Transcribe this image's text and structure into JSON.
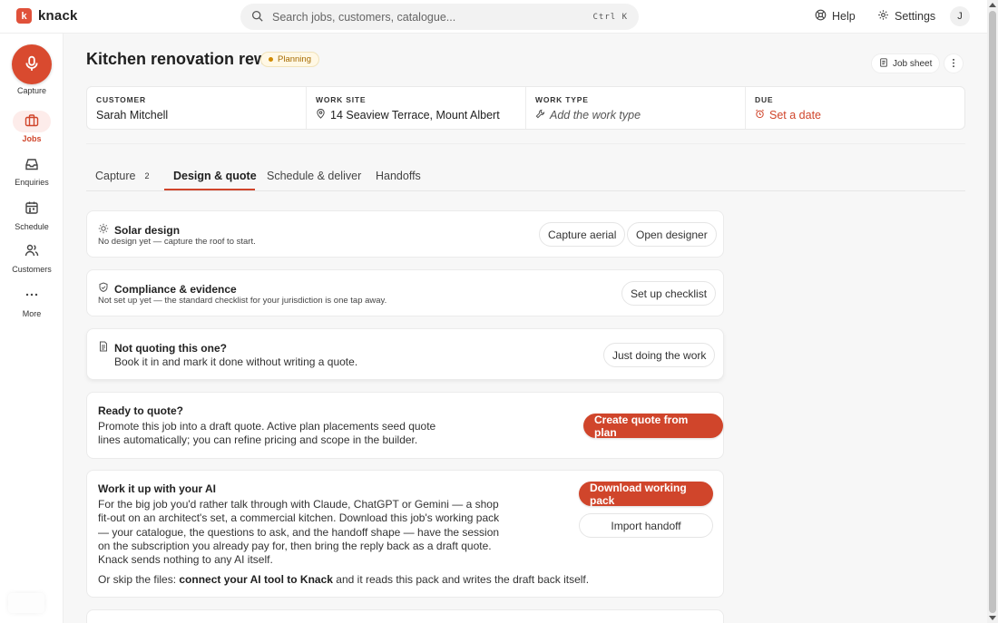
{
  "app": {
    "logo_letter": "k",
    "name": "knack"
  },
  "search": {
    "placeholder": "Search jobs, customers, catalogue...",
    "shortcut": "Ctrl K"
  },
  "topnav": {
    "help": "Help",
    "settings": "Settings",
    "avatar_initial": "J"
  },
  "sidebar": {
    "capture": "Capture",
    "items": [
      {
        "label": "Jobs",
        "icon": "briefcase-icon",
        "active": true
      },
      {
        "label": "Enquiries",
        "icon": "inbox-icon"
      },
      {
        "label": "Schedule",
        "icon": "calendar-icon"
      },
      {
        "label": "Customers",
        "icon": "users-icon"
      },
      {
        "label": "More",
        "icon": "dots-icon"
      }
    ]
  },
  "job": {
    "title": "Kitchen renovation rewire",
    "status": "Planning",
    "job_sheet": "Job sheet",
    "fields": {
      "customer_label": "CUSTOMER",
      "customer_value": "Sarah Mitchell",
      "site_label": "WORK SITE",
      "site_value": "14 Seaview Terrace, Mount Albert",
      "type_label": "WORK TYPE",
      "type_value": "Add the work type",
      "due_label": "DUE",
      "due_value": "Set a date"
    }
  },
  "tabs": {
    "capture": "Capture",
    "capture_count": "2",
    "design": "Design & quote",
    "schedule": "Schedule & deliver",
    "handoffs": "Handoffs"
  },
  "cards": {
    "solar": {
      "title": "Solar design",
      "sub": "No design yet — capture the roof to start.",
      "btn_aerial": "Capture aerial",
      "btn_designer": "Open designer"
    },
    "compliance": {
      "title": "Compliance & evidence",
      "sub": "Not set up yet — the standard checklist for your jurisdiction is one tap away.",
      "btn": "Set up checklist"
    },
    "noquote": {
      "title": "Not quoting this one?",
      "body": "Book it in and mark it done without writing a quote.",
      "btn": "Just doing the work"
    },
    "quote": {
      "title": "Ready to quote?",
      "body": "Promote this job into a draft quote. Active plan placements seed quote lines automatically; you can refine pricing and scope in the builder.",
      "btn": "Create quote from plan"
    },
    "ai": {
      "title": "Work it up with your AI",
      "body": "For the big job you'd rather talk through with Claude, ChatGPT or Gemini — a shop fit-out on an architect's set, a commercial kitchen. Download this job's working pack — your catalogue, the questions to ask, and the handoff shape — have the session on the subscription you already pay for, then bring the reply back as a draft quote. Knack sends nothing to any AI itself.",
      "skip_prefix": "Or skip the files:",
      "skip_link": "connect your AI tool to Knack",
      "skip_suffix": "and it reads this pack and writes the draft back itself.",
      "btn_download": "Download working pack",
      "btn_import": "Import handoff"
    }
  }
}
